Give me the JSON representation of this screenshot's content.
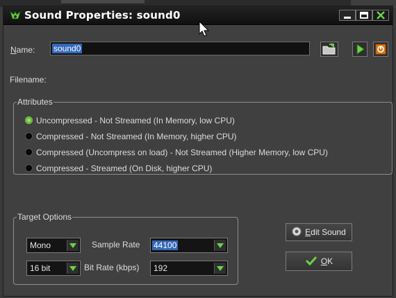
{
  "window": {
    "title": "Sound Properties: sound0"
  },
  "name": {
    "label_prefix": "N",
    "label_rest": "ame:",
    "value": "sound0"
  },
  "filename": {
    "label": "Filename:"
  },
  "attributes": {
    "legend": "Attributes",
    "options": [
      {
        "label": "Uncompressed - Not Streamed (In Memory, low CPU)",
        "selected": true
      },
      {
        "label": "Compressed - Not Streamed (In Memory, higher CPU)",
        "selected": false
      },
      {
        "label": "Compressed (Uncompress on load) - Not Streamed (Higher Memory, low CPU)",
        "selected": false
      },
      {
        "label": "Compressed - Streamed (On Disk, higher CPU)",
        "selected": false
      }
    ]
  },
  "target_options": {
    "legend": "Target Options",
    "channels": "Mono",
    "bit_depth": "16 bit",
    "sample_rate_label": "Sample Rate",
    "sample_rate": "44100",
    "bit_rate_label": "Bit Rate (kbps)",
    "bit_rate": "192"
  },
  "buttons": {
    "edit_sound_prefix": "E",
    "edit_sound_rest": "dit Sound",
    "ok_prefix": "O",
    "ok_rest": "K"
  },
  "colors": {
    "accent_green": "#6bd24a",
    "selection_blue": "#3468b8",
    "window_bg": "#404040"
  },
  "icons": [
    "game-maker-logo-icon",
    "open-folder-icon",
    "play-icon",
    "stop-icon",
    "edit-sound-icon",
    "checkmark-icon"
  ]
}
